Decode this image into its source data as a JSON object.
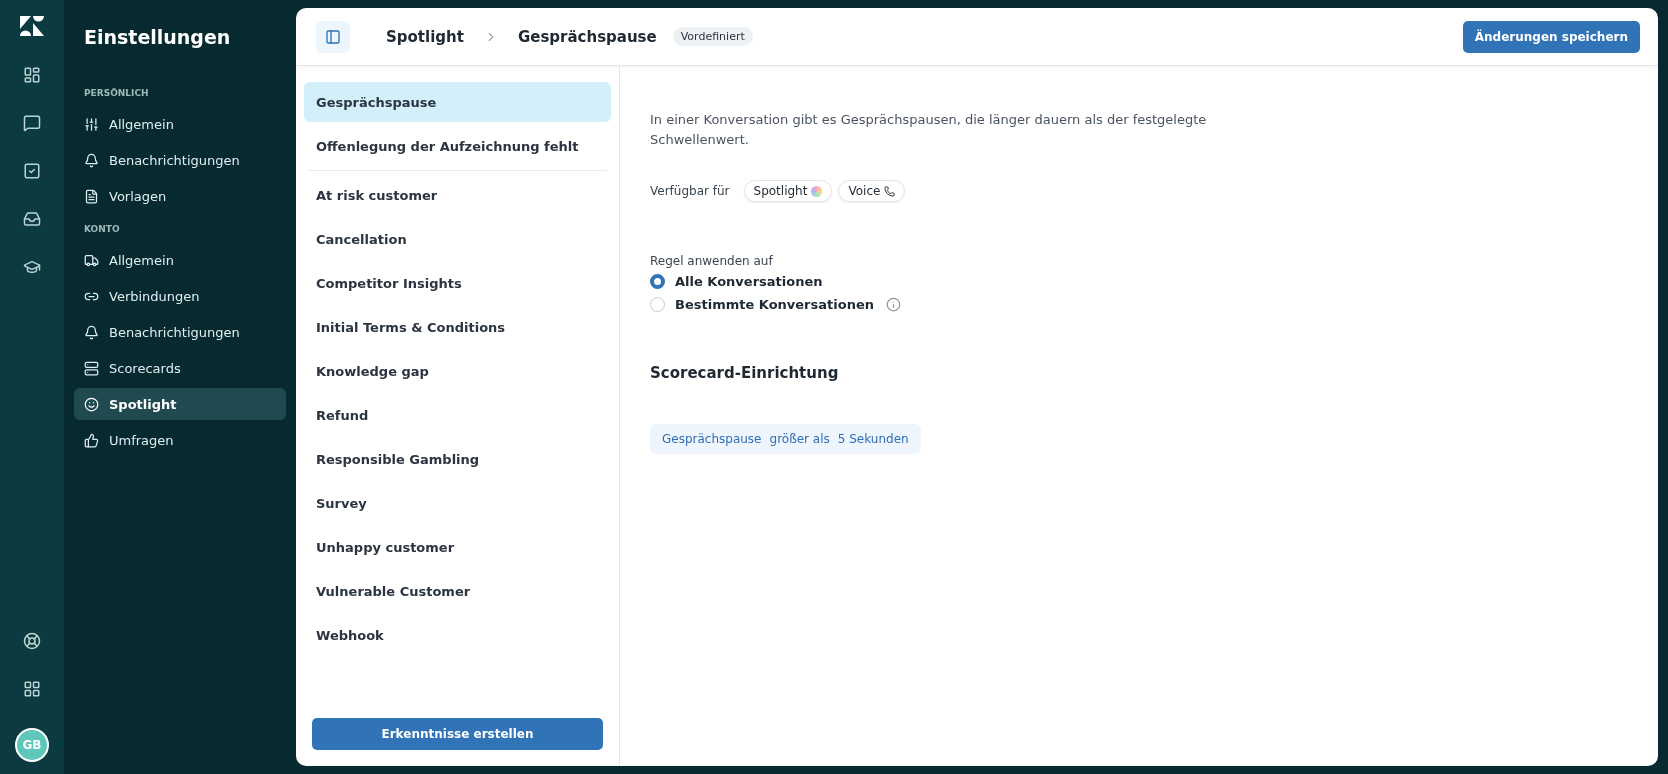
{
  "rail": {
    "avatar": "GB"
  },
  "sidebar": {
    "title": "Einstellungen",
    "sections": [
      {
        "heading": "PERSÖNLICH",
        "items": [
          {
            "label": "Allgemein",
            "selected": false
          },
          {
            "label": "Benachrichtigungen",
            "selected": false
          },
          {
            "label": "Vorlagen",
            "selected": false
          }
        ]
      },
      {
        "heading": "KONTO",
        "items": [
          {
            "label": "Allgemein",
            "selected": false
          },
          {
            "label": "Verbindungen",
            "selected": false
          },
          {
            "label": "Benachrichtigungen",
            "selected": false
          },
          {
            "label": "Scorecards",
            "selected": false
          },
          {
            "label": "Spotlight",
            "selected": true
          },
          {
            "label": "Umfragen",
            "selected": false
          }
        ]
      }
    ]
  },
  "header": {
    "breadcrumb": [
      "Spotlight",
      "Gesprächspause"
    ],
    "badge": "Vordefiniert",
    "save_button": "Änderungen speichern"
  },
  "insights": {
    "items": [
      {
        "label": "Gesprächspause",
        "selected": true
      },
      {
        "label": "Offenlegung der Aufzeichnung fehlt",
        "selected": false
      },
      {
        "label": "At risk customer",
        "selected": false
      },
      {
        "label": "Cancellation",
        "selected": false
      },
      {
        "label": "Competitor Insights",
        "selected": false
      },
      {
        "label": "Initial Terms & Conditions",
        "selected": false
      },
      {
        "label": "Knowledge gap",
        "selected": false
      },
      {
        "label": "Refund",
        "selected": false
      },
      {
        "label": "Responsible Gambling",
        "selected": false
      },
      {
        "label": "Survey",
        "selected": false
      },
      {
        "label": "Unhappy customer",
        "selected": false
      },
      {
        "label": "Vulnerable Customer",
        "selected": false
      },
      {
        "label": "Webhook",
        "selected": false
      }
    ],
    "create_button": "Erkenntnisse erstellen"
  },
  "detail": {
    "description": "In einer Konversation gibt es Gesprächspausen, die länger dauern als der festgelegte Schwellenwert.",
    "available_label": "Verfügbar für",
    "channels": [
      {
        "label": "Spotlight",
        "kind": "spotlight"
      },
      {
        "label": "Voice",
        "kind": "voice"
      }
    ],
    "apply_label": "Regel anwenden auf",
    "options": [
      {
        "label": "Alle Konversationen",
        "selected": true,
        "info": false
      },
      {
        "label": "Bestimmte Konversationen",
        "selected": false,
        "info": true
      }
    ],
    "scorecard_title": "Scorecard-Einrichtung",
    "condition": [
      "Gesprächspause",
      "größer als",
      "5 Sekunden"
    ]
  }
}
